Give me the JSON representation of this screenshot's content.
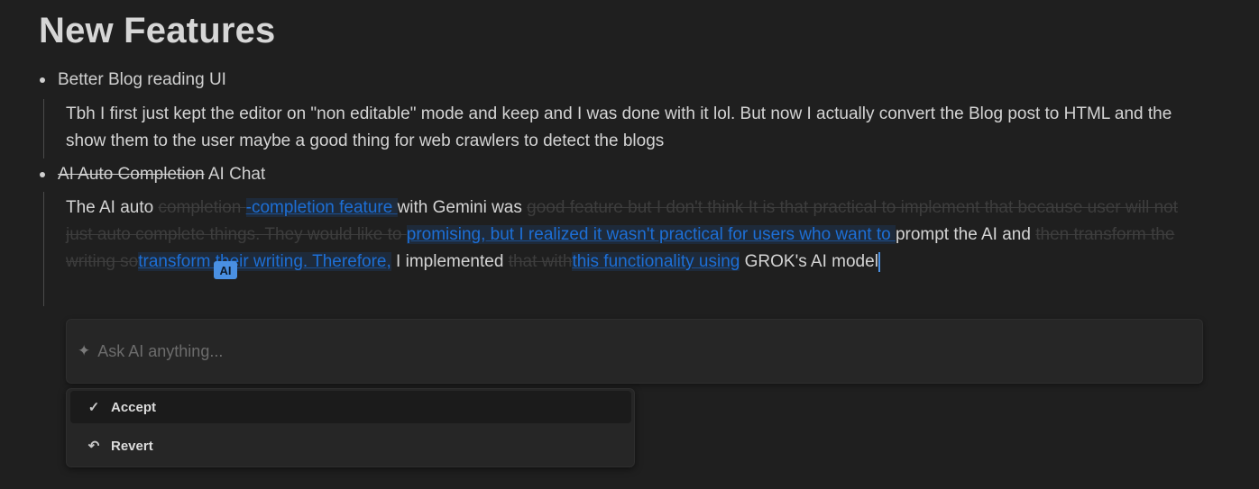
{
  "page": {
    "title": "New Features"
  },
  "items": [
    {
      "bullet": "Better Blog reading UI",
      "paragraph": "Tbh I first just kept the editor on \"non editable\" mode and keep and I was done with it lol. But now I actually convert the Blog post to HTML and the show them to the user maybe a good thing for web crawlers to detect the blogs"
    },
    {
      "bullet_struck": "AI Auto Completion",
      "bullet_rest": " AI Chat",
      "segments": [
        {
          "t": "The AI auto ",
          "k": "normal"
        },
        {
          "t": "completion ",
          "k": "del"
        },
        {
          "t": "-completion feature ",
          "k": "ins"
        },
        {
          "t": "with Gemini was ",
          "k": "normal"
        },
        {
          "t": "good feature but I don't think It is that practical to implement that because user will not just auto complete things. They would like to ",
          "k": "del"
        },
        {
          "t": "promising, but I realized it wasn't practical for users who want to ",
          "k": "ins"
        },
        {
          "t": "prompt the AI and ",
          "k": "normal"
        },
        {
          "t": "then transform the writing so",
          "k": "del"
        },
        {
          "t": "transform their writing. Therefore,",
          "k": "ins"
        },
        {
          "t": " I implemented ",
          "k": "normal"
        },
        {
          "t": "that with",
          "k": "del"
        },
        {
          "t": "this functionality using",
          "k": "ins"
        },
        {
          "t": " GROK's AI model",
          "k": "normal"
        }
      ]
    }
  ],
  "ai_tag": "AI",
  "ask": {
    "placeholder": "Ask AI anything...",
    "icon": "sparkle-icon"
  },
  "menu": [
    {
      "label": "Accept",
      "icon": "check-icon"
    },
    {
      "label": "Revert",
      "icon": "undo-icon"
    }
  ]
}
